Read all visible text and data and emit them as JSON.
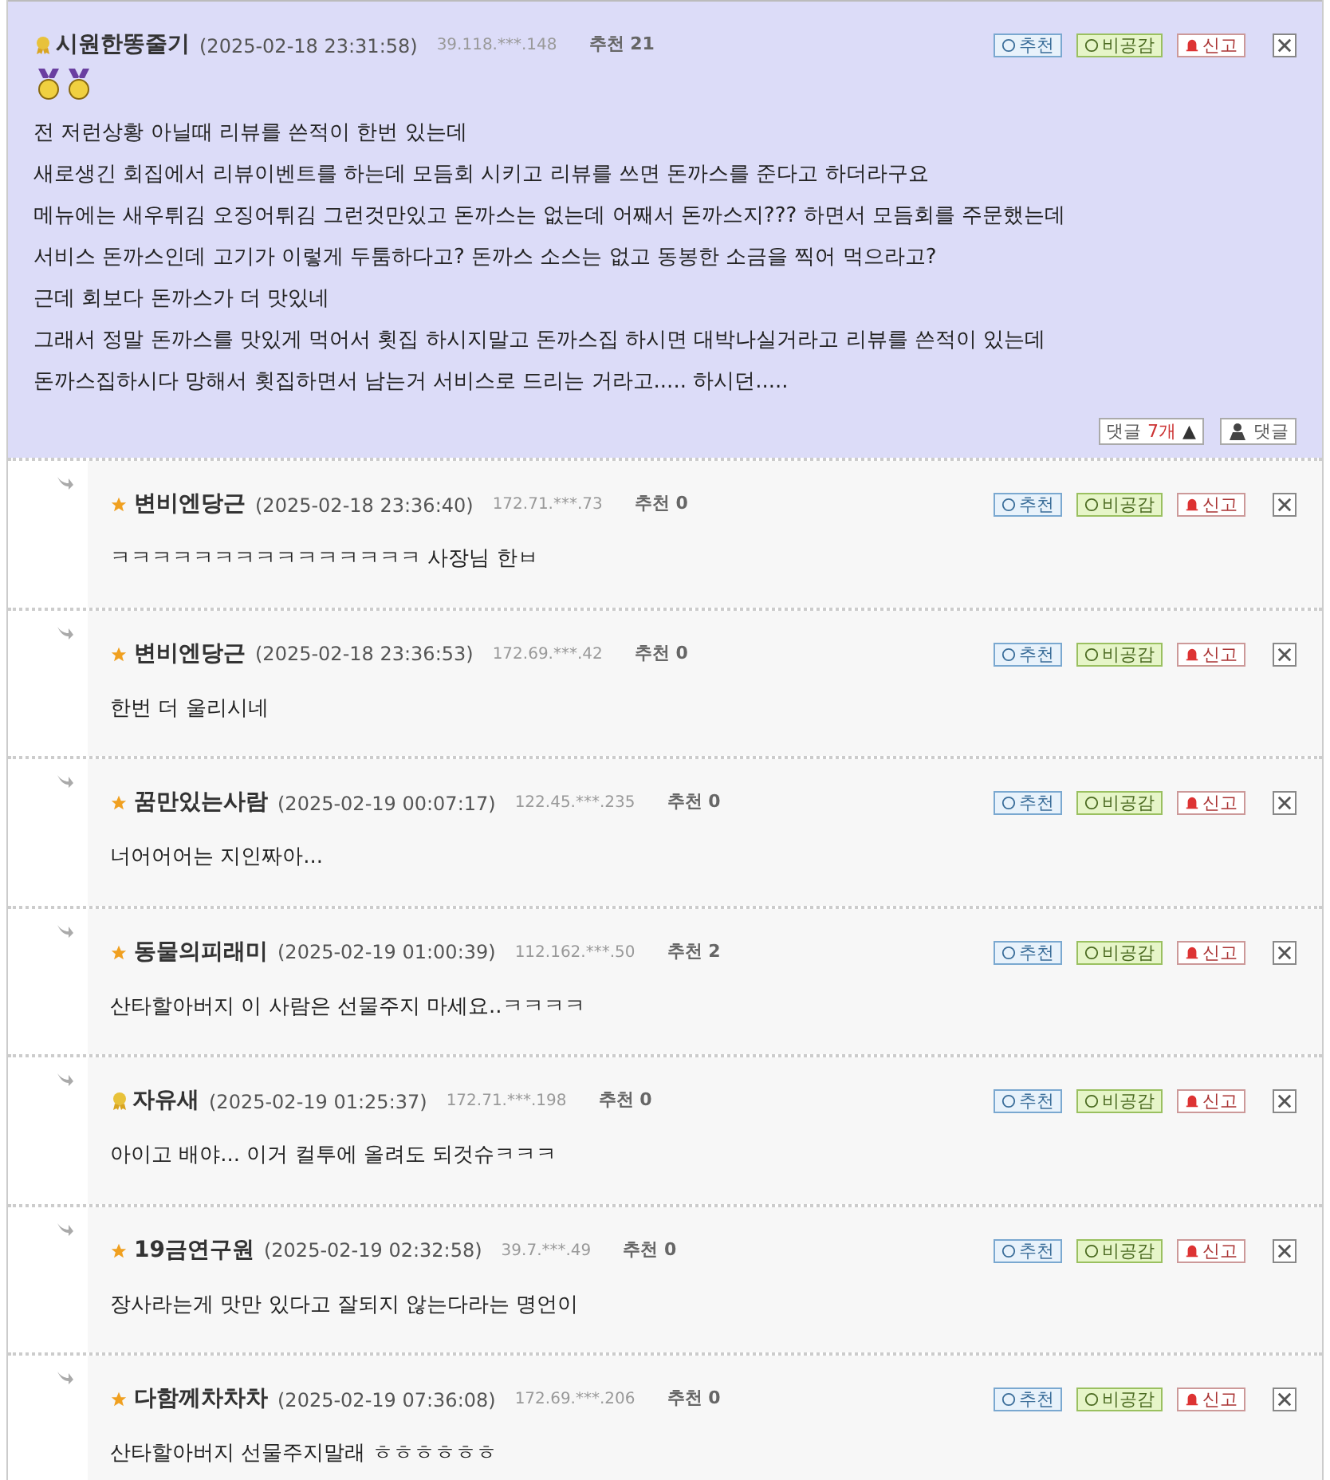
{
  "post": {
    "author": "시원한똥줄기",
    "kind": "medal",
    "date": "(2025-02-18 23:31:58)",
    "ip": "39.118.***.148",
    "recommend": "추천 21",
    "actions": {
      "recommend": "추천",
      "disagree": "비공감",
      "report": "신고"
    },
    "lines": [
      "전 저런상황 아닐때 리뷰를 쓴적이 한번 있는데",
      "새로생긴 회집에서 리뷰이벤트를 하는데 모듬회 시키고 리뷰를 쓰면 돈까스를 준다고 하더라구요",
      "메뉴에는 새우튀김 오징어튀김 그런것만있고 돈까스는 없는데 어째서 돈까스지??? 하면서 모듬회를 주문했는데",
      "서비스 돈까스인데 고기가 이렇게 두툼하다고? 돈까스 소스는 없고 동봉한 소금을 찍어 먹으라고?",
      "근데 회보다 돈까스가 더 맛있네",
      "그래서 정말 돈까스를 맛있게 먹어서 횟집 하시지말고 돈까스집 하시면 대박나실거라고 리뷰를 쓴적이 있는데",
      "돈까스집하시다 망해서 횟집하면서 남는거 서비스로 드리는 거라고..... 하시던....."
    ],
    "replies_label": "댓글",
    "replies_count": "7개",
    "collapse": "▲",
    "reply_button": "댓글"
  },
  "replies": [
    {
      "author": "변비엔당근",
      "kind": "star",
      "date": "(2025-02-18 23:36:40)",
      "ip": "172.71.***.73",
      "recommend": "추천 0",
      "actions": {
        "recommend": "추천",
        "disagree": "비공감",
        "report": "신고"
      },
      "text": "ㅋㅋㅋㅋㅋㅋㅋㅋㅋㅋㅋㅋㅋㅋㅋ 사장님 한ㅂ"
    },
    {
      "author": "변비엔당근",
      "kind": "star",
      "date": "(2025-02-18 23:36:53)",
      "ip": "172.69.***.42",
      "recommend": "추천 0",
      "actions": {
        "recommend": "추천",
        "disagree": "비공감",
        "report": "신고"
      },
      "text": "한번 더 울리시네"
    },
    {
      "author": "꿈만있는사람",
      "kind": "star",
      "date": "(2025-02-19 00:07:17)",
      "ip": "122.45.***.235",
      "recommend": "추천 0",
      "actions": {
        "recommend": "추천",
        "disagree": "비공감",
        "report": "신고"
      },
      "text": "너어어어는 지인짜아..."
    },
    {
      "author": "동물의피래미",
      "kind": "star",
      "date": "(2025-02-19 01:00:39)",
      "ip": "112.162.***.50",
      "recommend": "추천 2",
      "actions": {
        "recommend": "추천",
        "disagree": "비공감",
        "report": "신고"
      },
      "text": "산타할아버지 이 사람은 선물주지 마세요..ㅋㅋㅋㅋ"
    },
    {
      "author": "자유새",
      "kind": "medal",
      "date": "(2025-02-19 01:25:37)",
      "ip": "172.71.***.198",
      "recommend": "추천 0",
      "actions": {
        "recommend": "추천",
        "disagree": "비공감",
        "report": "신고"
      },
      "text": "아이고 배야... 이거 컬투에 올려도 되것슈ㅋㅋㅋ"
    },
    {
      "author": "19금연구원",
      "kind": "star",
      "date": "(2025-02-19 02:32:58)",
      "ip": "39.7.***.49",
      "recommend": "추천 0",
      "actions": {
        "recommend": "추천",
        "disagree": "비공감",
        "report": "신고"
      },
      "text": "장사라는게 맛만 있다고 잘되지 않는다라는 명언이"
    },
    {
      "author": "다함께차차차",
      "kind": "star",
      "date": "(2025-02-19 07:36:08)",
      "ip": "172.69.***.206",
      "recommend": "추천 0",
      "actions": {
        "recommend": "추천",
        "disagree": "비공감",
        "report": "신고"
      },
      "text": "산타할아버지 선물주지말래 ㅎㅎㅎㅎㅎㅎ"
    }
  ]
}
